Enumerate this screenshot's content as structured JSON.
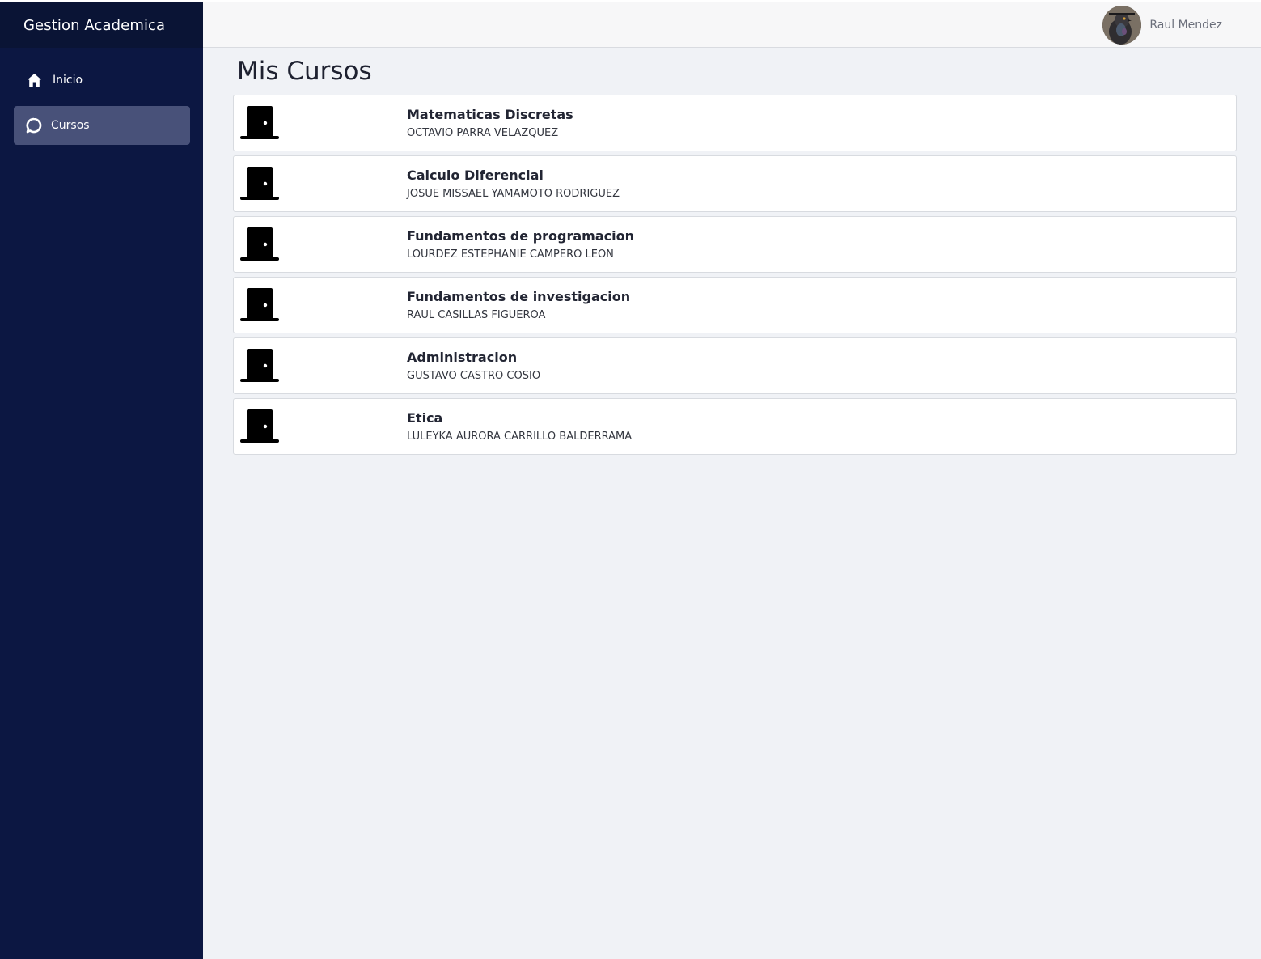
{
  "app": {
    "brand": "Gestion Academica"
  },
  "sidebar": {
    "items": [
      {
        "label": "Inicio",
        "icon": "home-icon",
        "active": false
      },
      {
        "label": "Cursos",
        "icon": "chat-bubble-icon",
        "active": true
      }
    ]
  },
  "header": {
    "user_name": "Raul Mendez",
    "avatar": "user-avatar-pigeon"
  },
  "main": {
    "title": "Mis Cursos",
    "courses": [
      {
        "name": "Matematicas Discretas",
        "teacher": "OCTAVIO PARRA VELAZQUEZ",
        "icon": "door-icon"
      },
      {
        "name": "Calculo Diferencial",
        "teacher": "JOSUE MISSAEL YAMAMOTO RODRIGUEZ",
        "icon": "door-icon"
      },
      {
        "name": "Fundamentos de programacion",
        "teacher": "LOURDEZ ESTEPHANIE CAMPERO LEON",
        "icon": "door-icon"
      },
      {
        "name": "Fundamentos de investigacion",
        "teacher": "RAUL CASILLAS FIGUEROA",
        "icon": "door-icon"
      },
      {
        "name": "Administracion",
        "teacher": "GUSTAVO CASTRO COSIO",
        "icon": "door-icon"
      },
      {
        "name": "Etica",
        "teacher": "LULEYKA AURORA CARRILLO BALDERRAMA",
        "icon": "door-icon"
      }
    ]
  },
  "colors": {
    "sidebar_bg": "#0c1742",
    "sidebar_brand_bg": "#0a1435",
    "active_item_bg": "#485179",
    "page_bg": "#f0f2f6",
    "card_bg": "#ffffff"
  }
}
